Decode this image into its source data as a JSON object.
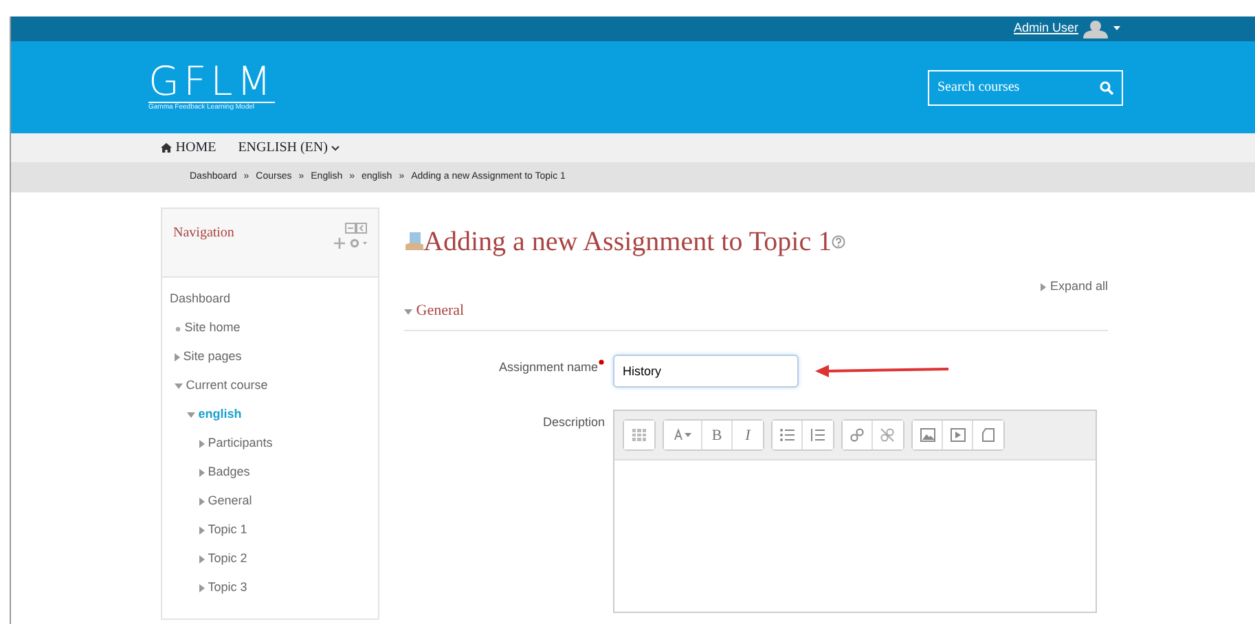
{
  "user_menu": {
    "name": "Admin User"
  },
  "logo": {
    "title": "GFLM",
    "subtitle": "Gamma Feedback Learning Model"
  },
  "search": {
    "placeholder": "Search courses"
  },
  "menu": [
    {
      "label": "HOME",
      "kind": "home"
    },
    {
      "label": "ENGLISH (EN)",
      "kind": "dropdown"
    }
  ],
  "breadcrumb": {
    "separator": "»",
    "items": [
      "Dashboard",
      "Courses",
      "English",
      "english",
      "Adding a new Assignment to Topic 1"
    ]
  },
  "navigation": {
    "title": "Navigation",
    "items": [
      {
        "label": "Dashboard",
        "kind": "plain",
        "children": [
          {
            "label": "Site home",
            "kind": "leaf"
          },
          {
            "label": "Site pages",
            "kind": "branch",
            "expanded": false
          },
          {
            "label": "Current course",
            "kind": "branch",
            "expanded": true,
            "children": [
              {
                "label": "english",
                "kind": "branch",
                "expanded": true,
                "current": true,
                "children": [
                  {
                    "label": "Participants",
                    "kind": "branch",
                    "expanded": false
                  },
                  {
                    "label": "Badges",
                    "kind": "branch",
                    "expanded": false
                  },
                  {
                    "label": "General",
                    "kind": "branch",
                    "expanded": false
                  },
                  {
                    "label": "Topic 1",
                    "kind": "branch",
                    "expanded": false
                  },
                  {
                    "label": "Topic 2",
                    "kind": "branch",
                    "expanded": false
                  },
                  {
                    "label": "Topic 3",
                    "kind": "branch",
                    "expanded": false
                  }
                ]
              }
            ]
          }
        ]
      }
    ]
  },
  "page": {
    "title": "Adding a new Assignment to Topic 1",
    "expand_all": "Expand all",
    "section": {
      "title": "General",
      "expanded": true
    },
    "fields": [
      {
        "kind": "text",
        "label": "Assignment name",
        "required": true,
        "value": "History",
        "annotated": true
      },
      {
        "kind": "editor",
        "label": "Description",
        "required": false,
        "toolbar": [
          [
            {
              "kind": "table"
            }
          ],
          [
            {
              "kind": "font"
            },
            {
              "kind": "bold",
              "text": "B"
            },
            {
              "kind": "italic",
              "text": "I"
            }
          ],
          [
            {
              "kind": "bullets"
            },
            {
              "kind": "numbers"
            }
          ],
          [
            {
              "kind": "link"
            },
            {
              "kind": "unlink"
            }
          ],
          [
            {
              "kind": "image"
            },
            {
              "kind": "media"
            },
            {
              "kind": "file"
            }
          ]
        ]
      }
    ]
  }
}
